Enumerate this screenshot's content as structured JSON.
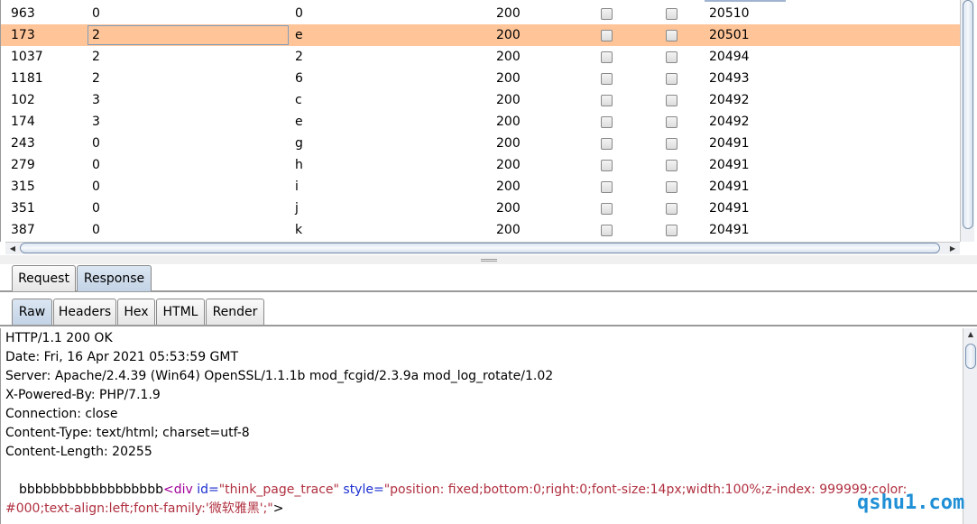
{
  "results": {
    "rows": [
      {
        "request": "963",
        "payload1": "0",
        "payload2": "0",
        "status": "200",
        "length": "20510"
      },
      {
        "request": "173",
        "payload1": "2",
        "payload2": "e",
        "status": "200",
        "length": "20501",
        "selected": true
      },
      {
        "request": "1037",
        "payload1": "2",
        "payload2": "2",
        "status": "200",
        "length": "20494"
      },
      {
        "request": "1181",
        "payload1": "2",
        "payload2": "6",
        "status": "200",
        "length": "20493"
      },
      {
        "request": "102",
        "payload1": "3",
        "payload2": "c",
        "status": "200",
        "length": "20492"
      },
      {
        "request": "174",
        "payload1": "3",
        "payload2": "e",
        "status": "200",
        "length": "20492"
      },
      {
        "request": "243",
        "payload1": "0",
        "payload2": "g",
        "status": "200",
        "length": "20491"
      },
      {
        "request": "279",
        "payload1": "0",
        "payload2": "h",
        "status": "200",
        "length": "20491"
      },
      {
        "request": "315",
        "payload1": "0",
        "payload2": "i",
        "status": "200",
        "length": "20491"
      },
      {
        "request": "351",
        "payload1": "0",
        "payload2": "j",
        "status": "200",
        "length": "20491"
      },
      {
        "request": "387",
        "payload1": "0",
        "payload2": "k",
        "status": "200",
        "length": "20491"
      }
    ]
  },
  "tabs_top": {
    "request": "Request",
    "response": "Response",
    "active": "response"
  },
  "tabs_view": {
    "raw": "Raw",
    "headers": "Headers",
    "hex": "Hex",
    "html": "HTML",
    "render": "Render",
    "active": "raw"
  },
  "response": {
    "headers": [
      "HTTP/1.1 200 OK",
      "Date: Fri, 16 Apr 2021 05:53:59 GMT",
      "Server: Apache/2.4.39 (Win64) OpenSSL/1.1.1b mod_fcgid/2.3.9a mod_log_rotate/1.02",
      "X-Powered-By: PHP/7.1.9",
      "Connection: close",
      "Content-Type: text/html; charset=utf-8",
      "Content-Length: 20255"
    ],
    "body_line1": {
      "prefix": "bbbbbbbbbbbbbbbbbb",
      "tag_open": "<div",
      "attr1": " id=",
      "val1": "\"think_page_trace\"",
      "attr2": " style=",
      "val2a": "\"position: fixed;bottom:0;right:0;font-size:14px;width:100%;z-index: 999999;color:"
    },
    "body_line2": {
      "val2b": "#000;text-align:left;font-family:'微软雅黑';\"",
      "close": ">"
    }
  },
  "watermark": "qshu1.com",
  "colors": {
    "selected_row": "#ffc599",
    "tab_active": "#c3d3e6",
    "watermark": "#1f8fd6"
  }
}
